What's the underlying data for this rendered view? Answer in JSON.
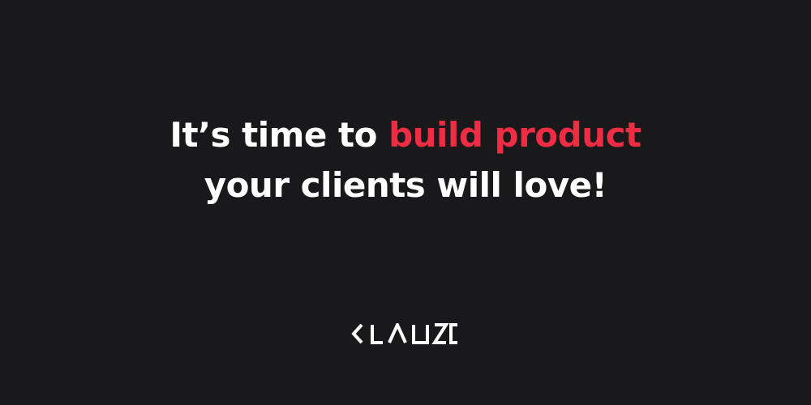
{
  "headline": {
    "line1_prefix": "It’s time to ",
    "line1_highlight": "build product",
    "line2": "your clients will love!"
  },
  "logo": {
    "text": "KLAUZE",
    "icon": "klauze-wordmark-logo"
  },
  "colors": {
    "background": "#19191b",
    "text": "#ffffff",
    "accent": "#ee2c44"
  }
}
